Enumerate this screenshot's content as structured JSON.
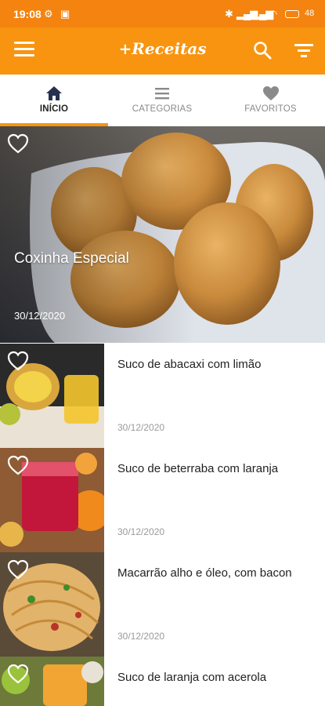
{
  "status_bar": {
    "time": "19:08",
    "battery": "48"
  },
  "app_bar": {
    "title": "+Receitas",
    "menu_icon": "hamburger-menu-icon",
    "search_icon": "search-icon",
    "filter_icon": "filter-icon"
  },
  "tabs": [
    {
      "label": "INÍCIO",
      "icon": "home-icon",
      "active": true
    },
    {
      "label": "CATEGORIAS",
      "icon": "list-icon",
      "active": false
    },
    {
      "label": "FAVORITOS",
      "icon": "heart-icon",
      "active": false
    }
  ],
  "featured": {
    "title": "Coxinha Especial",
    "date": "30/12/2020"
  },
  "recipes": [
    {
      "title": "Suco de abacaxi com limão",
      "date": "30/12/2020"
    },
    {
      "title": "Suco de beterraba com laranja",
      "date": "30/12/2020"
    },
    {
      "title": "Macarrão alho e óleo, com bacon",
      "date": "30/12/2020"
    },
    {
      "title": "Suco de laranja com acerola",
      "date": ""
    }
  ],
  "colors": {
    "accent": "#f8940f",
    "status_bar": "#f4830f"
  }
}
